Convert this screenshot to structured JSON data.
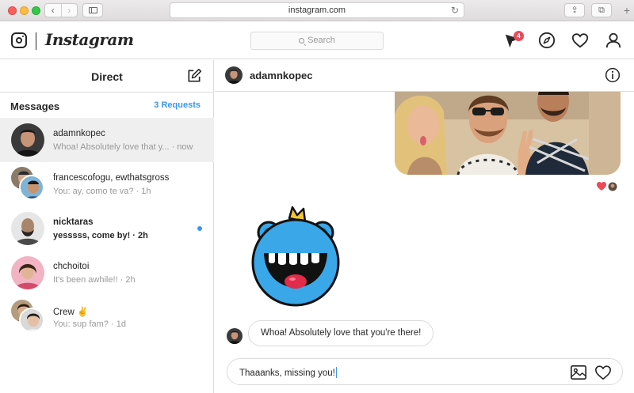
{
  "browser": {
    "url": "instagram.com",
    "back_glyph": "‹",
    "forward_glyph": "›",
    "reload_glyph": "↻",
    "share_glyph": "⇪",
    "tabs_glyph": "⧉",
    "new_tab_glyph": "+"
  },
  "header": {
    "brand": "Instagram",
    "search_placeholder": "Search",
    "notification_count": "4",
    "icons": [
      "direct-icon",
      "explore-icon",
      "heart-icon",
      "profile-icon"
    ]
  },
  "sidebar": {
    "title": "Direct",
    "messages_label": "Messages",
    "requests_label": "3 Requests",
    "conversations": [
      {
        "name": "adamnkopec",
        "preview": "Whoa! Absolutely love that y... · now",
        "active": true,
        "unread": false
      },
      {
        "name": "francescofogu, ewthatsgross",
        "preview": "You: ay, como te va? · 1h",
        "active": false,
        "unread": false
      },
      {
        "name": "nicktaras",
        "preview": "yesssss, come by! · 2h",
        "active": false,
        "unread": true
      },
      {
        "name": "chchoitoi",
        "preview": "It's been awhile!! · 2h",
        "active": false,
        "unread": false
      },
      {
        "name": "Crew ✌️",
        "preview": "You: sup fam? · 1d",
        "active": false,
        "unread": false
      }
    ]
  },
  "chat": {
    "username": "adamnkopec",
    "received_message": "Whoa! Absolutely love that you're there!",
    "composer_value": "Thaaanks, missing you!"
  },
  "colors": {
    "accent": "#3897f0",
    "badge": "#ed4956",
    "border": "#dbdbdb",
    "sticker_blue": "#3aa7e8"
  }
}
